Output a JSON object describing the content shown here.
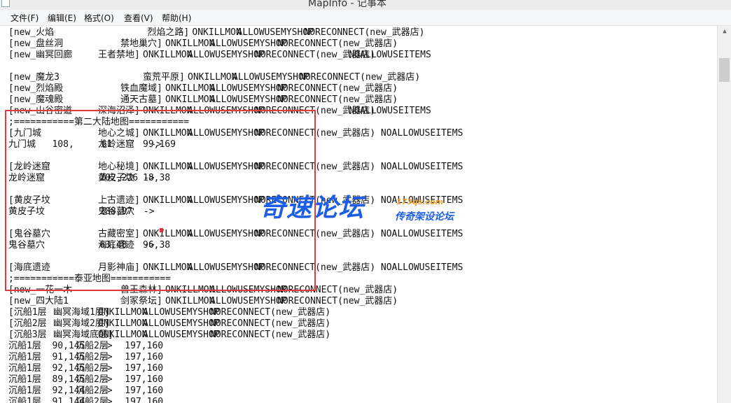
{
  "window": {
    "title": "MapInfo - 记事本"
  },
  "menu": [
    {
      "id": "file",
      "label": "文件(F)"
    },
    {
      "id": "edit",
      "label": "编辑(E)"
    },
    {
      "id": "format",
      "label": "格式(O)"
    },
    {
      "id": "view",
      "label": "查看(V)"
    },
    {
      "id": "help",
      "label": "帮助(H)"
    }
  ],
  "lines": [
    {
      "segs": [
        {
          "c": 0,
          "t": "[new_火焰"
        },
        {
          "c": 31,
          "t": "烈焰之路]"
        },
        {
          "c": 41,
          "t": "ONKILLMON"
        },
        {
          "c": 51,
          "t": "ALLOWUSEMYSHOP"
        },
        {
          "c": 66,
          "t": "NORECONNECT(new_武器店)"
        }
      ]
    },
    {
      "segs": [
        {
          "c": 0,
          "t": "[new_盘丝洞"
        },
        {
          "c": 25,
          "t": "禁地巢穴]"
        },
        {
          "c": 35,
          "t": "ONKILLMON"
        },
        {
          "c": 45,
          "t": "ALLOWUSEMYSHOP"
        },
        {
          "c": 60,
          "t": "NORECONNECT(new_武器店)"
        }
      ]
    },
    {
      "segs": [
        {
          "c": 0,
          "t": "[new_幽冥回廊"
        },
        {
          "c": 20,
          "t": "王者禁地]"
        },
        {
          "c": 30,
          "t": "ONKILLMON"
        },
        {
          "c": 40,
          "t": "ALLOWUSEMYSHOP"
        },
        {
          "c": 55,
          "t": "NORECONNECT(new_武器店)"
        },
        {
          "c": 76,
          "t": "NOALLOWUSEITEMS"
        }
      ]
    },
    {
      "segs": []
    },
    {
      "segs": [
        {
          "c": 0,
          "t": "[new_魔龙3"
        },
        {
          "c": 30,
          "t": "蛮荒平原]"
        },
        {
          "c": 40,
          "t": "ONKILLMON"
        },
        {
          "c": 50,
          "t": "ALLOWUSEMYSHOP"
        },
        {
          "c": 65,
          "t": "NORECONNECT(new_武器店)"
        }
      ]
    },
    {
      "segs": [
        {
          "c": 0,
          "t": "[new_烈焰殿"
        },
        {
          "c": 25,
          "t": "铁血魔域]"
        },
        {
          "c": 35,
          "t": "ONKILLMON"
        },
        {
          "c": 45,
          "t": "ALLOWUSEMYSHOP"
        },
        {
          "c": 60,
          "t": "NORECONNECT(new_武器店)"
        }
      ]
    },
    {
      "segs": [
        {
          "c": 0,
          "t": "[new_魔魂殿"
        },
        {
          "c": 25,
          "t": "通天古墓]"
        },
        {
          "c": 35,
          "t": "ONKILLMON"
        },
        {
          "c": 45,
          "t": "ALLOWUSEMYSHOP"
        },
        {
          "c": 60,
          "t": "NORECONNECT(new_武器店)"
        }
      ]
    },
    {
      "segs": [
        {
          "c": 0,
          "t": "[new_山谷密道"
        },
        {
          "c": 20,
          "t": "深海沼泽]"
        },
        {
          "c": 30,
          "t": "ONKILLMON"
        },
        {
          "c": 40,
          "t": "ALLOWUSEMYSHOP"
        },
        {
          "c": 55,
          "t": "NORECONNECT(new_武器店)"
        },
        {
          "c": 76,
          "t": "NOALLOWUSEITEMS"
        }
      ]
    },
    {
      "segs": [
        {
          "c": 0,
          "t": ";===========第二大陆地图==========="
        }
      ]
    },
    {
      "segs": [
        {
          "c": 0,
          "t": "[九门城"
        },
        {
          "c": 20,
          "t": "地心之城]"
        },
        {
          "c": 30,
          "t": "ONKILLMON"
        },
        {
          "c": 40,
          "t": "ALLOWUSEMYSHOP"
        },
        {
          "c": 55,
          "t": "NORECONNECT(new_武器店) NOALLOWUSEITEMS"
        }
      ]
    },
    {
      "segs": [
        {
          "c": 0,
          "t": "九门城   108,     61       ->"
        },
        {
          "c": 20,
          "t": "龙岭迷窟"
        },
        {
          "c": 30,
          "t": "99,169"
        }
      ]
    },
    {
      "segs": []
    },
    {
      "segs": [
        {
          "c": 0,
          "t": "[龙岭迷窟"
        },
        {
          "c": 20,
          "t": "地心秘境]"
        },
        {
          "c": 30,
          "t": "ONKILLMON"
        },
        {
          "c": 40,
          "t": "ALLOWUSEMYSHOP"
        },
        {
          "c": 55,
          "t": "NORECONNECT(new_武器店) NOALLOWUSEITEMS"
        }
      ]
    },
    {
      "segs": [
        {
          "c": 0,
          "t": "龙岭迷窟          202,226 ->"
        },
        {
          "c": 20,
          "t": "黄皮子坟"
        },
        {
          "c": 30,
          "t": "18,38"
        }
      ]
    },
    {
      "segs": []
    },
    {
      "segs": [
        {
          "c": 0,
          "t": "[黄皮子坟"
        },
        {
          "c": 20,
          "t": "上古遗迹]"
        },
        {
          "c": 30,
          "t": "ONKILLMON"
        },
        {
          "c": 40,
          "t": "ALLOWUSEMYSHOP"
        },
        {
          "c": 55,
          "t": "NORECONNECT(new_武器店) NOALLOWUSEITEMS"
        }
      ]
    },
    {
      "segs": [
        {
          "c": 0,
          "t": "黄皮子坟          288,97  ->"
        },
        {
          "c": 20,
          "t": "鬼谷墓穴"
        }
      ]
    },
    {
      "segs": []
    },
    {
      "segs": [
        {
          "c": 0,
          "t": "[鬼谷墓穴"
        },
        {
          "c": 20,
          "t": "古藏密室]"
        },
        {
          "c": 30,
          "t": "ONKILLMON"
        },
        {
          "c": 40,
          "t": "ALLOWUSEMYSHOP"
        },
        {
          "c": 55,
          "t": "NORECONNECT(new_武器店) NOALLOWUSEITEMS"
        }
      ]
    },
    {
      "segs": [
        {
          "c": 0,
          "t": "鬼谷墓穴          63,48   ->"
        },
        {
          "c": 20,
          "t": "海底遗迹"
        },
        {
          "c": 30,
          "t": "96,38"
        }
      ]
    },
    {
      "segs": []
    },
    {
      "segs": [
        {
          "c": 0,
          "t": "[海底遗迹"
        },
        {
          "c": 20,
          "t": "月影神庙]"
        },
        {
          "c": 30,
          "t": "ONKILLMON"
        },
        {
          "c": 40,
          "t": "ALLOWUSEMYSHOP"
        },
        {
          "c": 55,
          "t": "NORECONNECT(new_武器店) NOALLOWUSEITEMS"
        }
      ]
    },
    {
      "segs": [
        {
          "c": 0,
          "t": ";===========泰亚地图==========="
        }
      ]
    },
    {
      "segs": [
        {
          "c": 0,
          "t": "[new_一花一木"
        },
        {
          "c": 25,
          "t": "兽王森林]"
        },
        {
          "c": 35,
          "t": "ONKILLMON"
        },
        {
          "c": 45,
          "t": "ALLOWUSEMYSHOP"
        },
        {
          "c": 60,
          "t": "NORECONNECT(new_武器店)"
        }
      ]
    },
    {
      "segs": [
        {
          "c": 0,
          "t": "[new_四大陆1"
        },
        {
          "c": 25,
          "t": "剑冢祭坛]"
        },
        {
          "c": 35,
          "t": "ONKILLMON"
        },
        {
          "c": 45,
          "t": "ALLOWUSEMYSHOP"
        },
        {
          "c": 60,
          "t": "NORECONNECT(new_武器店)"
        }
      ]
    },
    {
      "segs": [
        {
          "c": 0,
          "t": "[沉船1层"
        },
        {
          "c": 10,
          "t": "幽冥海域1层]"
        },
        {
          "c": 20,
          "t": "ONKILLMON"
        },
        {
          "c": 30,
          "t": "ALLOWUSEMYSHOP"
        },
        {
          "c": 45,
          "t": "NORECONNECT(new_武器店)"
        }
      ]
    },
    {
      "segs": [
        {
          "c": 0,
          "t": "[沉船2层"
        },
        {
          "c": 10,
          "t": "幽冥海域2层]"
        },
        {
          "c": 20,
          "t": "ONKILLMON"
        },
        {
          "c": 30,
          "t": "ALLOWUSEMYSHOP"
        },
        {
          "c": 45,
          "t": "NORECONNECT(new_武器店)"
        }
      ]
    },
    {
      "segs": [
        {
          "c": 0,
          "t": "[沉船3层"
        },
        {
          "c": 10,
          "t": "幽冥海域底层]"
        },
        {
          "c": 20,
          "t": "ONKILLMON"
        },
        {
          "c": 30,
          "t": "ALLOWUSEMYSHOP"
        },
        {
          "c": 45,
          "t": "NORECONNECT(new_武器店)"
        }
      ]
    },
    {
      "segs": [
        {
          "c": 0,
          "t": "沉船1层  90,145   ->"
        },
        {
          "c": 15,
          "t": "沉船2层   197,160"
        }
      ]
    },
    {
      "segs": [
        {
          "c": 0,
          "t": "沉船1层  91,145   ->"
        },
        {
          "c": 15,
          "t": "沉船2层   197,160"
        }
      ]
    },
    {
      "segs": [
        {
          "c": 0,
          "t": "沉船1层  92,145   ->"
        },
        {
          "c": 15,
          "t": "沉船2层   197,160"
        }
      ]
    },
    {
      "segs": [
        {
          "c": 0,
          "t": "沉船1层  89,145   ->"
        },
        {
          "c": 15,
          "t": "沉船2层   197,160"
        }
      ]
    },
    {
      "segs": [
        {
          "c": 0,
          "t": "沉船1层  92,144   ->"
        },
        {
          "c": 15,
          "t": "沉船2层   197,160"
        }
      ]
    },
    {
      "segs": [
        {
          "c": 0,
          "t": "沉船1层  91,144   ->"
        },
        {
          "c": 15,
          "t": "沉船2层   197,160"
        }
      ]
    }
  ],
  "watermark": {
    "main": "奇速论坛",
    "url": "173qs.com",
    "sub": "传奇架设论坛",
    "color": "#1d5ee6"
  },
  "highlight_color": "#e23b3b"
}
